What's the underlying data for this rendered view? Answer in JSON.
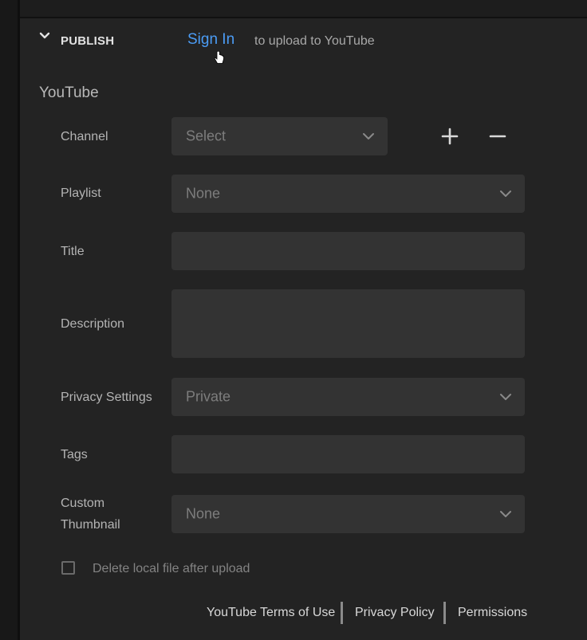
{
  "publish": {
    "section_title": "PUBLISH",
    "sign_in_link": "Sign In",
    "sign_in_suffix": "to upload to YouTube"
  },
  "youtube": {
    "group_title": "YouTube",
    "channel": {
      "label": "Channel",
      "value": "Select"
    },
    "playlist": {
      "label": "Playlist",
      "value": "None"
    },
    "title": {
      "label": "Title",
      "value": ""
    },
    "description": {
      "label": "Description",
      "value": ""
    },
    "privacy": {
      "label": "Privacy Settings",
      "value": "Private"
    },
    "tags": {
      "label": "Tags",
      "value": ""
    },
    "thumbnail": {
      "label_line1": "Custom",
      "label_line2": "Thumbnail",
      "value": "None"
    },
    "delete_local": {
      "label": "Delete local file after upload",
      "checked": false
    }
  },
  "footer": {
    "terms": "YouTube Terms of Use",
    "privacy_policy": "Privacy Policy",
    "permissions": "Permissions"
  },
  "colors": {
    "link": "#4b9cf5",
    "panel_bg": "#232323",
    "field_bg": "#333333"
  },
  "icons": [
    "chevron-down-icon",
    "plus-icon",
    "minus-icon",
    "pointer-cursor-icon"
  ]
}
